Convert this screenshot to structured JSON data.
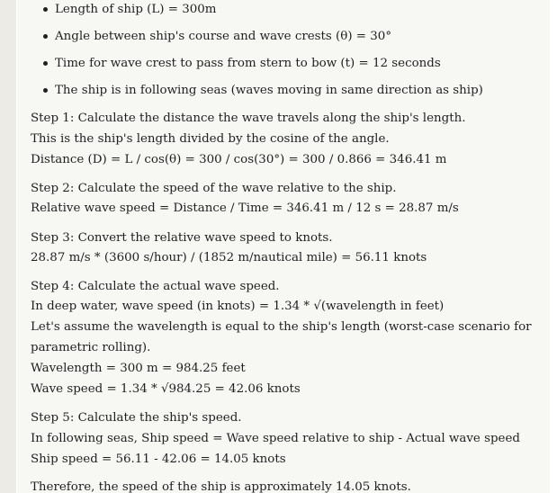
{
  "given": [
    "Length of ship (L) = 300m",
    "Angle between ship's course and wave crests (θ) = 30°",
    "Time for wave crest to pass from stern to bow (t) = 12 seconds",
    "The ship is in following seas (waves moving in same direction as ship)"
  ],
  "step1": {
    "heading": "Step 1: Calculate the distance the wave travels along the ship's length.",
    "line1": "This is the ship's length divided by the cosine of the angle.",
    "line2": "Distance (D) = L / cos(θ) = 300 / cos(30°) = 300 / 0.866 = 346.41 m"
  },
  "step2": {
    "heading": "Step 2: Calculate the speed of the wave relative to the ship.",
    "line1": "Relative wave speed = Distance / Time = 346.41 m / 12 s = 28.87 m/s"
  },
  "step3": {
    "heading": "Step 3: Convert the relative wave speed to knots.",
    "line1": "28.87 m/s * (3600 s/hour) / (1852 m/nautical mile) = 56.11 knots"
  },
  "step4": {
    "heading": "Step 4: Calculate the actual wave speed.",
    "line1": "In deep water, wave speed (in knots) = 1.34 * √(wavelength in feet)",
    "line2": "Let's assume the wavelength is equal to the ship's length (worst-case scenario for",
    "line3": "parametric rolling).",
    "line4": "Wavelength = 300 m = 984.25 feet",
    "line5": "Wave speed = 1.34 * √984.25 = 42.06 knots"
  },
  "step5": {
    "heading": "Step 5: Calculate the ship's speed.",
    "line1": "In following seas, Ship speed = Wave speed relative to ship - Actual wave speed",
    "line2": "Ship speed = 56.11 - 42.06 = 14.05 knots"
  },
  "conclusion": "Therefore, the speed of the ship is approximately 14.05 knots."
}
